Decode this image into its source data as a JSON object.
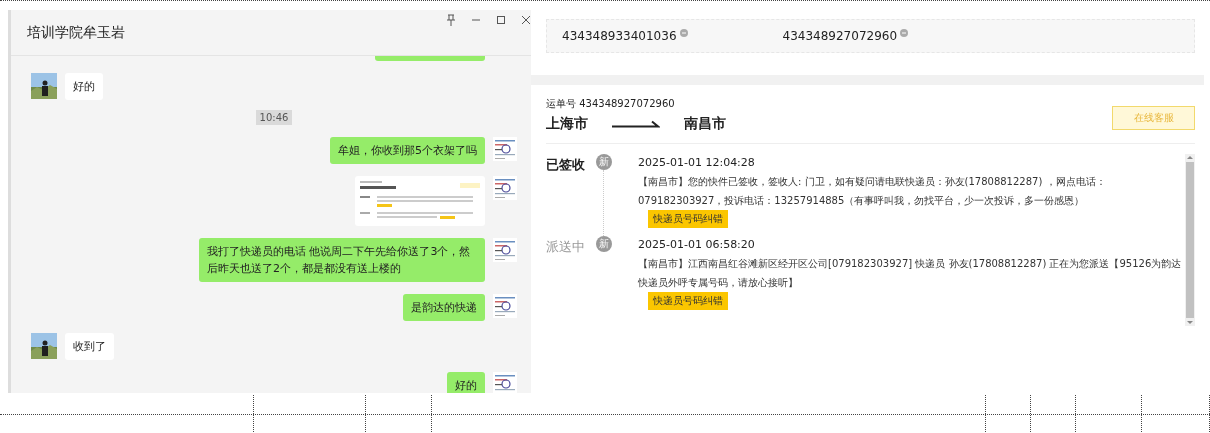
{
  "chat_window": {
    "title": "培训学院牟玉岩",
    "messages": [
      {
        "kind": "clipped_sent"
      },
      {
        "kind": "received",
        "text": "好的"
      },
      {
        "kind": "time",
        "text": "10:46"
      },
      {
        "kind": "sent",
        "text": "牟姐，你收到那5个衣架了吗"
      },
      {
        "kind": "sent_image"
      },
      {
        "kind": "sent",
        "text": "我打了快递员的电话  他说周二下午先给你送了3个，然后昨天也送了2个，都是都没有送上楼的"
      },
      {
        "kind": "sent",
        "text": "是韵达的快递"
      },
      {
        "kind": "received",
        "text": "收到了"
      },
      {
        "kind": "sent",
        "text": "好的"
      }
    ]
  },
  "tracking_panel": {
    "tracking_numbers": [
      "434348933401036",
      "434348927072960"
    ],
    "waybill": "运单号 434348927072960",
    "origin": "上海市",
    "destination": "南昌市",
    "service_button": "在线客服",
    "events": [
      {
        "status": "已签收",
        "current": true,
        "badge": "新",
        "time": "2025-01-01 12:04:28",
        "text": "【南昌市】您的快件已签收，签收人: 门卫，如有疑问请电联快递员：孙友(17808812287) ，网点电话：079182303927，投诉电话：13257914885（有事呼叫我，勿找平台，少一次投诉，多一份感恩）",
        "button": "快递员号码纠错"
      },
      {
        "status": "派送中",
        "current": false,
        "badge": "新",
        "time": "2025-01-01 06:58:20",
        "text": "【南昌市】江西南昌红谷滩新区经开区公司[079182303927] 快递员 孙友(17808812287) 正在为您派送【95126为韵达快递员外呼专属号码，请放心接听】",
        "button": "快递员号码纠错"
      }
    ]
  }
}
